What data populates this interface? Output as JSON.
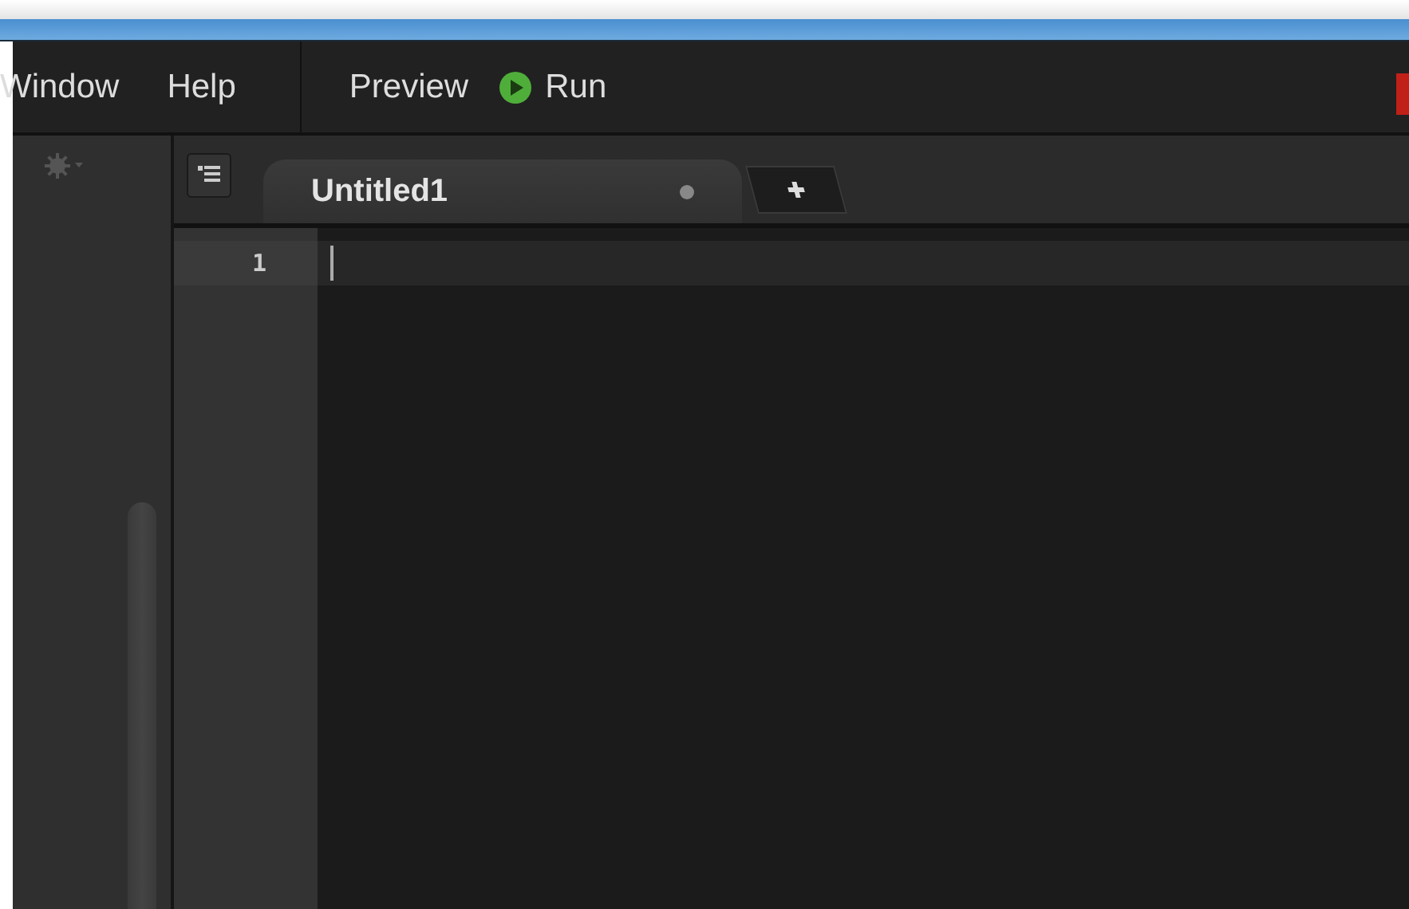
{
  "menu": [
    {
      "label": "Window"
    },
    {
      "label": "Help"
    }
  ],
  "toolbar": [
    {
      "label": "Preview",
      "kind": "plain"
    },
    {
      "label": "Run",
      "kind": "run"
    }
  ],
  "tabs": [
    {
      "label": "Untitled1",
      "selected": true,
      "modified": true
    }
  ],
  "editor": {
    "line_numbers": [
      "1"
    ]
  }
}
